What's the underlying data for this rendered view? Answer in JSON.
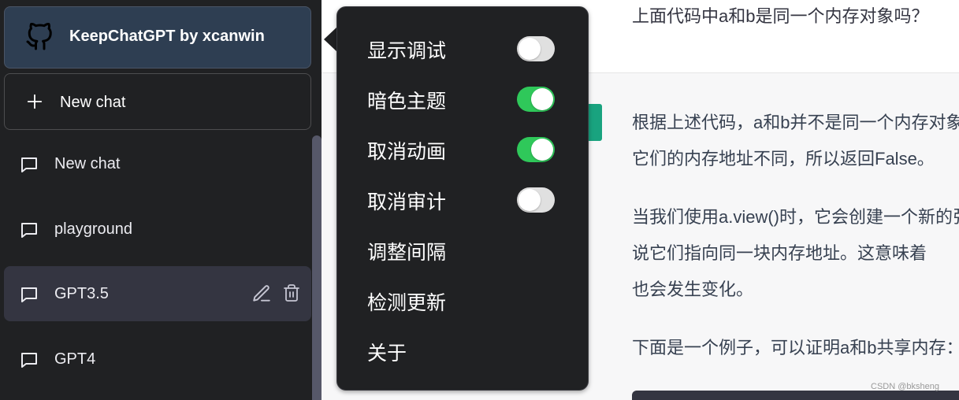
{
  "sidebar": {
    "brand_label": "KeepChatGPT by xcanwin",
    "new_chat_button": "New chat",
    "chats": [
      {
        "label": "New chat",
        "active": false
      },
      {
        "label": "playground",
        "active": false
      },
      {
        "label": "GPT3.5",
        "active": true
      },
      {
        "label": "GPT4",
        "active": false
      }
    ]
  },
  "menu": {
    "items": [
      {
        "label": "显示调试",
        "toggle": false
      },
      {
        "label": "暗色主题",
        "toggle": true
      },
      {
        "label": "取消动画",
        "toggle": true
      },
      {
        "label": "取消审计",
        "toggle": false
      },
      {
        "label": "调整间隔"
      },
      {
        "label": "检测更新"
      },
      {
        "label": "关于"
      }
    ]
  },
  "conversation": {
    "user_message": "上面代码中a和b是同一个内存对象吗？",
    "assistant_paragraphs": [
      [
        "根据上述代码，a和b并不是同一个内存对象，",
        "它们的内存地址不同，所以返回False。"
      ],
      [
        "当我们使用a.view()时，它会创建一个新的张量，",
        "说它们指向同一块内存地址。这意味着",
        "也会发生变化。"
      ],
      [
        "下面是一个例子，可以证明a和b共享内存："
      ]
    ]
  },
  "colors": {
    "toggle_on": "#2fc85a",
    "toggle_off": "#e0e0e0",
    "brand_bg": "#2e3e52",
    "avatar_bg": "#19a37f"
  },
  "watermark": "CSDN @bksheng"
}
